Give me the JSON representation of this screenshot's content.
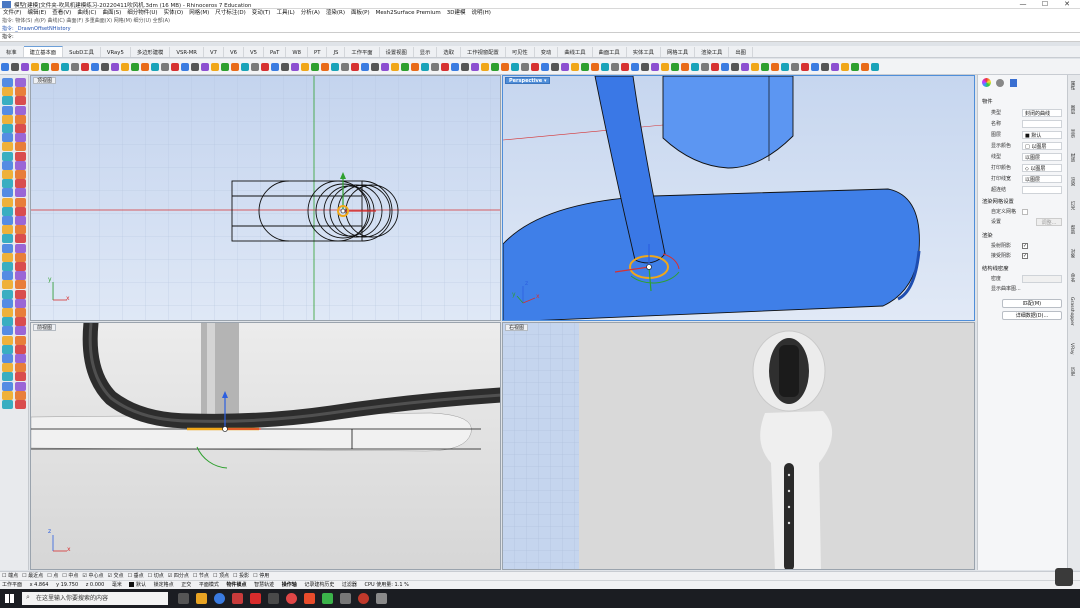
{
  "window": {
    "title": "模型[建模]文件夹-吹风机建模练习-20220411吹风机.3dm (16 MB) - Rhinoceros 7 Education",
    "minimize": "—",
    "maximize": "☐",
    "close": "✕"
  },
  "menu": [
    "文件(F)",
    "编辑(E)",
    "查看(V)",
    "曲线(C)",
    "曲面(S)",
    "细分物件(U)",
    "实体(O)",
    "网格(M)",
    "尺寸标注(D)",
    "变动(T)",
    "工具(L)",
    "分析(A)",
    "渲染(R)",
    "面板(P)",
    "Mesh2Surface Premium",
    "3D建模",
    "说明(H)"
  ],
  "command": {
    "history": "指令: 物体(S) 点(P) 曲线(C) 曲面(F) 多重曲面(X) 网格(M) 细分(U) 全部(A)",
    "last": "指令: _DrawnOffsetNHistory",
    "prompt": "指令:"
  },
  "tabs": {
    "items": [
      "标准",
      "建立基本面",
      "SubD工具",
      "VRay5",
      "多边形建模",
      "VSR-MR",
      "V7",
      "V6",
      "V5",
      "PaT",
      "W8",
      "PT",
      "JS",
      "工作平面",
      "设置视图",
      "显示",
      "选取",
      "工作视窗配置",
      "可见性",
      "变动",
      "曲线工具",
      "曲面工具",
      "实体工具",
      "网格工具",
      "渲染工具",
      "出图"
    ],
    "active": 1
  },
  "colors": {
    "accent": "#4f8ed9",
    "axis_x": "#d63131",
    "axis_y": "#2ea02e",
    "axis_z": "#2c5fe0",
    "selection": "#f0a71a",
    "shaded_blue": "#3f7fe8"
  },
  "viewports": {
    "top": {
      "label": "顶视图",
      "x_axis": "x",
      "y_axis": "y"
    },
    "perspective": {
      "label": "Perspective",
      "arrow": "▾",
      "x_axis": "x",
      "y_axis": "y",
      "z_axis": "z"
    },
    "front": {
      "label": "前视图",
      "x_axis": "x",
      "z_axis": "z"
    },
    "right": {
      "label": "右视图"
    }
  },
  "panel": {
    "section_object": "物件",
    "rows": [
      {
        "k": "类型",
        "v": "封闭的曲线"
      },
      {
        "k": "名称",
        "v": ""
      },
      {
        "k": "图层",
        "v": "■ 默认"
      },
      {
        "k": "显示颜色",
        "v": "□ 以图层"
      },
      {
        "k": "线型",
        "v": "以图层"
      },
      {
        "k": "打印颜色",
        "v": "◇ 以图层"
      },
      {
        "k": "打印线宽",
        "v": "以图层"
      },
      {
        "k": "超连结",
        "v": ""
      }
    ],
    "section_render_mesh": "渲染网格设置",
    "custom_mesh": "自定义网格",
    "custom_mesh_setting": "设置",
    "custom_mesh_btn": "调整...",
    "section_render": "渲染",
    "cast_shadow": "投射阴影",
    "receive_shadow": "接受阴影",
    "section_section": "结构线密度",
    "density": "密度",
    "show_curvature": "显示曲率图...",
    "match_btn": "匹配(M)",
    "details_btn": "详细数据(D)..."
  },
  "right_strip": [
    "属性",
    "图层",
    "显示",
    "材质",
    "渲染",
    "灯光",
    "帮助",
    "对象",
    "命名",
    "Grasshopper",
    "VRay",
    "历史"
  ],
  "snaps": [
    "端点",
    "最近点",
    "点",
    "中点",
    "中心点",
    "交点",
    "垂点",
    "切点",
    "四分点",
    "节点",
    "顶点",
    "投影",
    "停用"
  ],
  "status": {
    "plane": "工作平面",
    "x": "x 4.864",
    "y": "y 19.750",
    "z": "z 0.000",
    "unit": "毫米",
    "layer": "默认",
    "items": [
      "锁定格点",
      "正交",
      "平面模式",
      "物件锁点",
      "智慧轨迹",
      "操作轴",
      "记录建构历史",
      "过滤器",
      "CPU 使用量: 1.1 %"
    ]
  },
  "taskbar": {
    "search_placeholder": "在这里输入你要搜索的内容"
  }
}
